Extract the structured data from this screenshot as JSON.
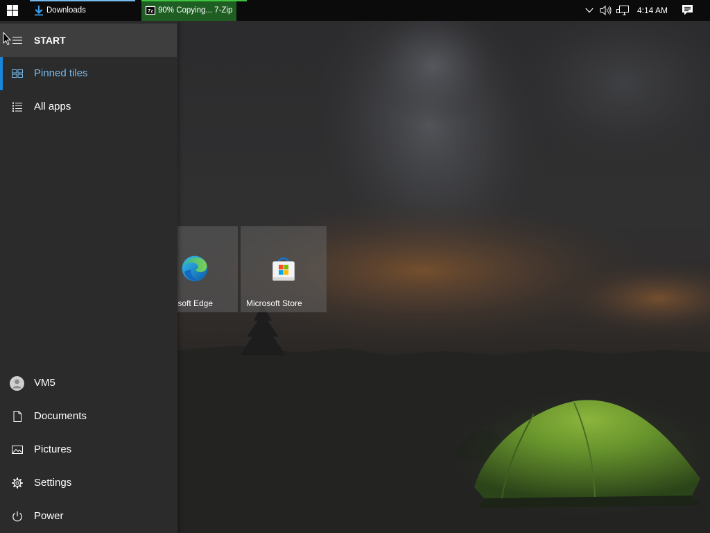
{
  "taskbar": {
    "start_button": {
      "icon": "windows-logo-icon"
    },
    "apps": [
      {
        "label": "Downloads",
        "icon": "download-arrow-icon",
        "accent_color": "#76b9ed"
      },
      {
        "label": "90% Copying... 7-Zip",
        "icon": "7zip-icon",
        "logo_text": "7z",
        "progress": 0.9,
        "progress_color": "#1f5e22",
        "accent_color": "#3fc43f"
      }
    ],
    "tray": {
      "icons": [
        "chevron-down-icon",
        "speaker-icon",
        "network-icon",
        "action-center-icon"
      ],
      "time": "4:14 AM"
    }
  },
  "start_menu": {
    "header": {
      "label": "START",
      "icon": "hamburger-menu-icon"
    },
    "nav": [
      {
        "label": "Pinned tiles",
        "icon": "tiles-icon",
        "selected": true
      },
      {
        "label": "All apps",
        "icon": "all-apps-list-icon",
        "selected": false
      }
    ],
    "bottom": [
      {
        "label": "VM5",
        "icon": "user-avatar-icon"
      },
      {
        "label": "Documents",
        "icon": "document-icon"
      },
      {
        "label": "Pictures",
        "icon": "pictures-icon"
      },
      {
        "label": "Settings",
        "icon": "gear-icon"
      },
      {
        "label": "Power",
        "icon": "power-icon"
      }
    ],
    "selected_accent_color": "#1a86d9",
    "selected_text_color": "#76b9ed"
  },
  "tiles": [
    {
      "label": "Microsoft Edge",
      "icon": "edge-icon"
    },
    {
      "label": "Microsoft Store",
      "icon": "store-icon"
    }
  ]
}
